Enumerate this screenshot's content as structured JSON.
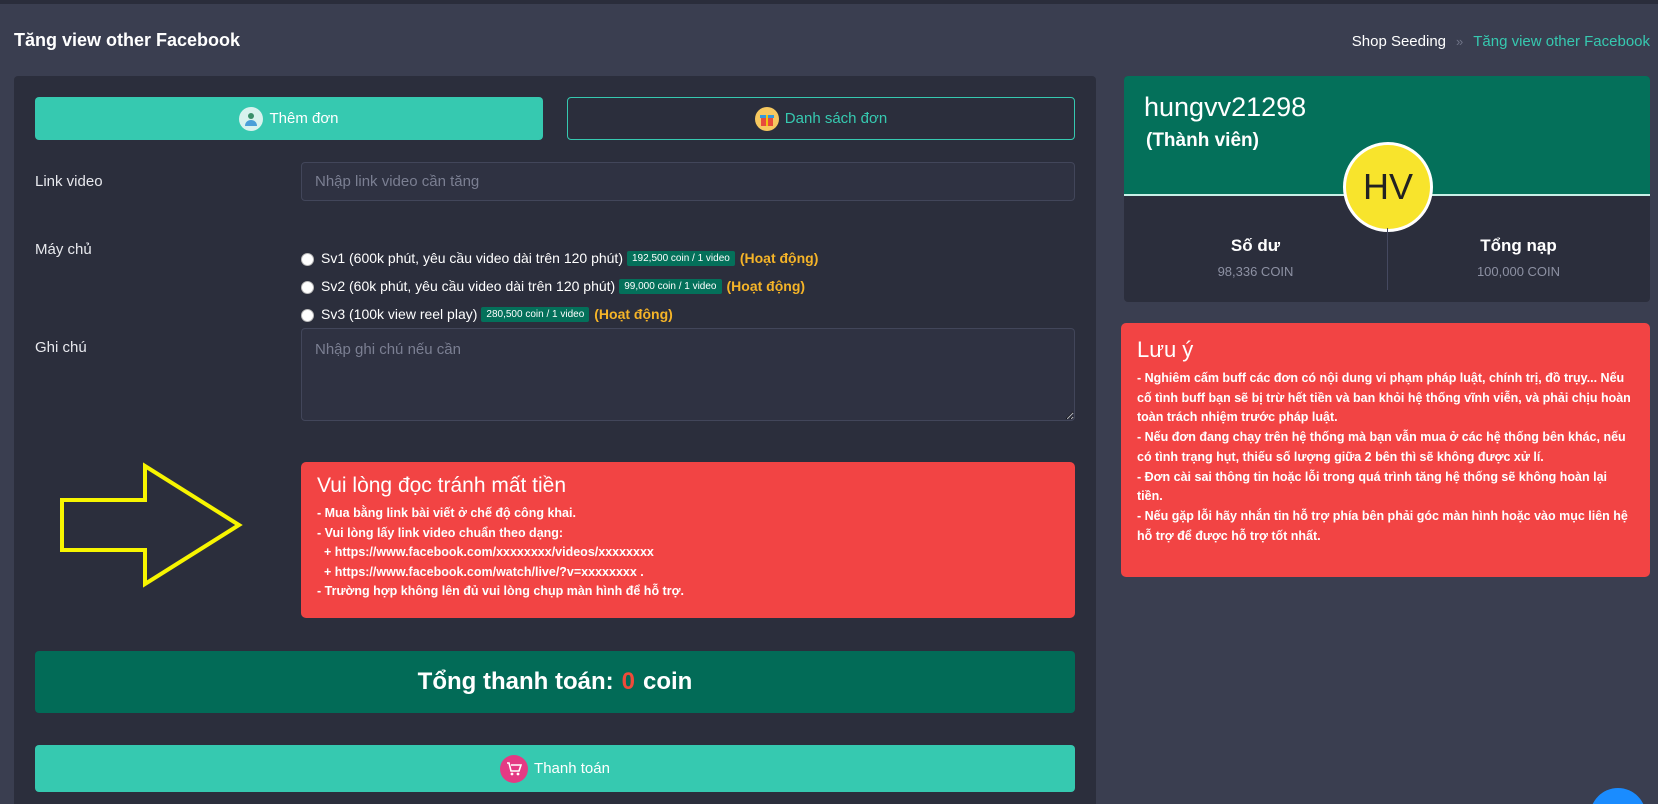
{
  "header": {
    "title": "Tăng view other Facebook",
    "breadcrumb_root": "Shop Seeding",
    "breadcrumb_sep": "»",
    "breadcrumb_current": "Tăng view other Facebook"
  },
  "tabs": {
    "add_label": "Thêm đơn",
    "list_label": "Danh sách đơn"
  },
  "form": {
    "link_label": "Link video",
    "link_placeholder": "Nhập link video cần tăng",
    "server_label": "Máy chủ",
    "servers": [
      {
        "name": "Sv1 (600k phút, yêu cầu video dài trên 120 phút)",
        "price": "192,500 coin / 1 video",
        "status": "(Hoạt động)"
      },
      {
        "name": "Sv2 (60k phút, yêu cầu video dài trên 120 phút)",
        "price": "99,000 coin / 1 video",
        "status": "(Hoạt động)"
      },
      {
        "name": "Sv3 (100k view reel play)",
        "price": "280,500 coin / 1 video",
        "status": "(Hoạt động)"
      }
    ],
    "note_label": "Ghi chú",
    "note_placeholder": "Nhập ghi chú nếu cần"
  },
  "warning": {
    "title": "Vui lòng đọc tránh mất tiền",
    "lines": [
      "- Mua bằng link bài viết ở chế độ công khai.",
      "- Vui lòng lấy link video chuẩn theo dạng:",
      "  + https://www.facebook.com/xxxxxxxx/videos/xxxxxxxx",
      "  + https://www.facebook.com/watch/live/?v=xxxxxxxx .",
      "- Trường hợp không lên đủ vui lòng chụp màn hình để hỗ trợ."
    ]
  },
  "total": {
    "label": "Tổng thanh toán:",
    "value": "0",
    "unit": "coin"
  },
  "pay_label": "Thanh toán",
  "profile": {
    "username": "hungvv21298",
    "role": "(Thành viên)",
    "initials": "HV",
    "balance_label": "Số dư",
    "balance_value": "98,336 COIN",
    "deposit_label": "Tổng nạp",
    "deposit_value": "100,000 COIN"
  },
  "notice": {
    "title": "Lưu ý",
    "lines": [
      "- Nghiêm cấm buff các đơn có nội dung vi phạm pháp luật, chính trị, đồ trụy... Nếu cố tình buff bạn sẽ bị trừ hết tiền và ban khỏi hệ thống vĩnh viễn, và phải chịu hoàn toàn trách nhiệm trước pháp luật.",
      "- Nếu đơn đang chạy trên hệ thống mà bạn vẫn mua ở các hệ thống bên khác, nếu có tình trạng hụt, thiếu số lượng giữa 2 bên thì sẽ không được xử lí.",
      "- Đơn cài sai thông tin hoặc lỗi trong quá trình tăng hệ thống sẽ không hoàn lại tiền.",
      "- Nếu gặp lỗi hãy nhắn tin hỗ trợ phía bên phải góc màn hình hoặc vào mục liên hệ hỗ trợ để được hỗ trợ tốt nhất."
    ]
  },
  "colors": {
    "accent": "#36c9b0",
    "dark_green": "#04705a",
    "danger": "#f24444",
    "status": "#f5b428",
    "avatar": "#f8e42c"
  },
  "icons": {
    "add_tab": "user-add-icon",
    "list_tab": "gift-list-icon",
    "pay": "cart-icon",
    "arrow": "arrow-right-icon",
    "chat": "chat-icon"
  }
}
